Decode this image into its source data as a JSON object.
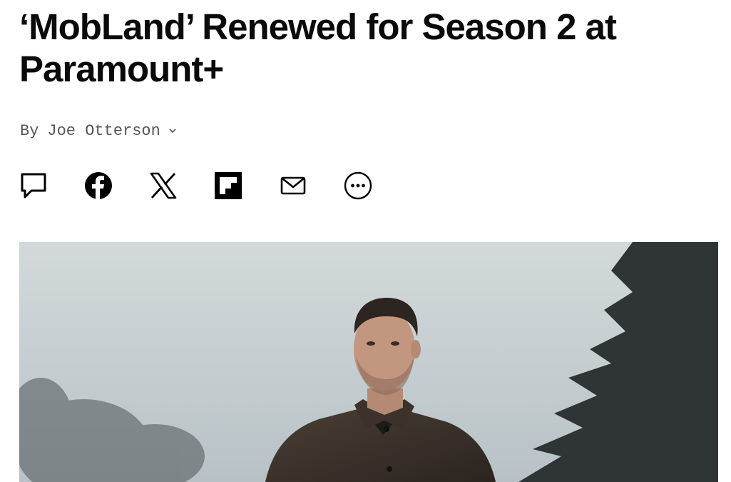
{
  "article": {
    "title": "‘MobLand’ Renewed for Season 2 at Paramount+",
    "byline_prefix": "By",
    "author": "Joe Otterson"
  },
  "share": {
    "items": [
      {
        "icon": "comment-icon"
      },
      {
        "icon": "facebook-icon"
      },
      {
        "icon": "x-icon"
      },
      {
        "icon": "flipboard-icon"
      },
      {
        "icon": "email-icon"
      },
      {
        "icon": "more-icon"
      }
    ]
  },
  "hero": {
    "icon": "hero-photo"
  },
  "colors": {
    "text": "#0a0a0a",
    "byline": "#555555",
    "sky": "#c9d1d4"
  }
}
